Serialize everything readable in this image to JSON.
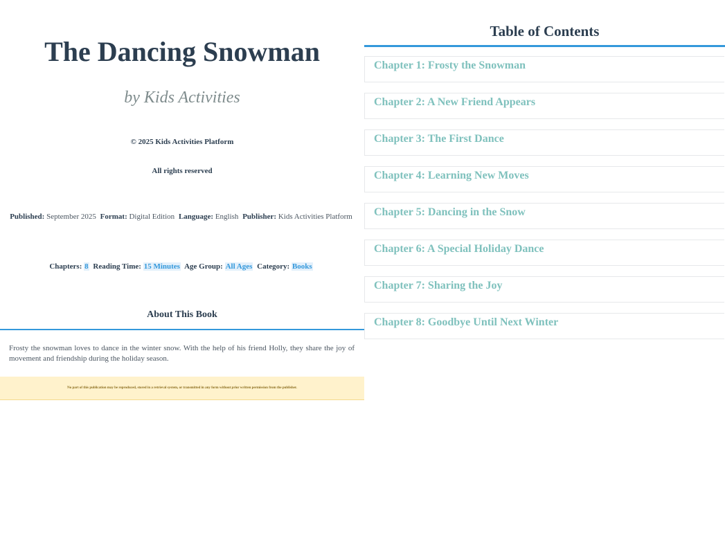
{
  "book": {
    "title": "The Dancing Snowman",
    "author": "by Kids Activities",
    "copyright": "© 2025 Kids Activities Platform",
    "rights": "All rights reserved"
  },
  "meta": {
    "published_label": "Published:",
    "published_value": "September 2025",
    "format_label": "Format:",
    "format_value": "Digital Edition",
    "language_label": "Language:",
    "language_value": "English",
    "publisher_label": "Publisher:",
    "publisher_value": "Kids Activities Platform",
    "chapters_label": "Chapters:",
    "chapters_value": "8",
    "reading_label": "Reading Time:",
    "reading_value": "15 Minutes",
    "age_label": "Age Group:",
    "age_value": "All Ages",
    "category_label": "Category:",
    "category_value": "Books"
  },
  "about": {
    "heading": "About This Book",
    "text": "Frosty the snowman loves to dance in the winter snow. With the help of his friend Holly, they share the joy of movement and friendship during the holiday season."
  },
  "notice": "No part of this publication may be reproduced, stored in a retrieval system, or transmitted in any form without prior written permission from the publisher.",
  "toc": {
    "title": "Table of Contents",
    "chapters": [
      "Chapter 1: Frosty the Snowman",
      "Chapter 2: A New Friend Appears",
      "Chapter 3: The First Dance",
      "Chapter 4: Learning New Moves",
      "Chapter 5: Dancing in the Snow",
      "Chapter 6: A Special Holiday Dance",
      "Chapter 7: Sharing the Joy",
      "Chapter 8: Goodbye Until Next Winter"
    ]
  },
  "colors": {
    "accent": "#3498db",
    "chapter_link": "#7fc1bd",
    "title": "#2c3e50",
    "author": "#7f8c8d",
    "notice_bg": "#fff2cc"
  }
}
